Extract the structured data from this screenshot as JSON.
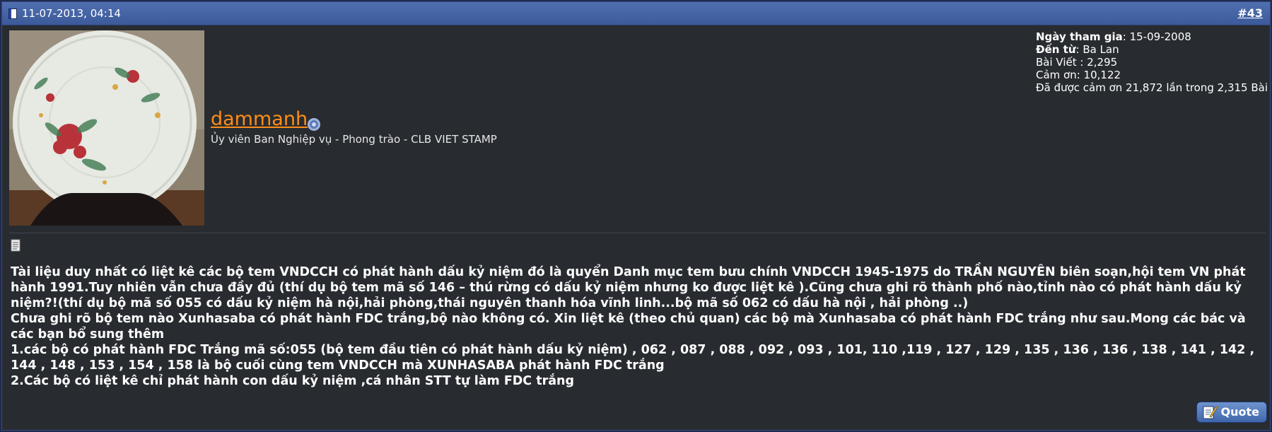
{
  "post": {
    "date": "11-07-2013, 04:14",
    "number_hash": "#",
    "number": "43",
    "username": "dammanh",
    "user_title": "Ủy viên Ban Nghiệp vụ - Phong trào - CLB VIET STAMP",
    "user_info": {
      "join_label": "Ngày tham gia",
      "join_value": ": 15-09-2008",
      "from_label": "Đến từ",
      "from_value": ": Ba Lan",
      "posts": "Bài Viết : 2,295",
      "thanks": "Cảm ơn: 10,122",
      "thanked": "Đã được cảm ơn 21,872 lần trong 2,315 Bài"
    },
    "message": {
      "lines": [
        "Tài liệu duy nhất có liệt kê các bộ tem VNDCCH có phát hành dấu kỷ niệm đó là quyển Danh mục tem bưu chính VNDCCH 1945-1975 do TRẦN NGUYÊN biên soạn,hội tem VN phát hành 1991.Tuy nhiên vẫn chưa đầy đủ (thí dụ bộ tem mã số 146 – thú rừng có dấu kỷ niệm nhưng ko được liệt kê ).Cũng chưa ghi rõ thành phố nào,tỉnh nào có phát hành dấu kỷ niệm?!(thí dụ bộ mã số 055 có dấu kỷ niệm hà nội,hải phòng,thái nguyên thanh hóa vĩnh linh...bộ mã số 062 có dấu hà nội , hải phòng ..)",
        "Chưa ghi rõ bộ tem nào Xunhasaba có phát hành FDC trắng,bộ nào không có. Xin liệt kê (theo chủ quan) các bộ mà Xunhasaba có phát hành FDC trắng như sau.Mong các bác và các bạn bổ sung thêm",
        "1.các bộ có phát hành FDC Trắng mã số:055 (bộ tem đầu tiên có phát hành dấu kỷ niệm) , 062 , 087 , 088 , 092 , 093 , 101, 110 ,119 , 127 , 129 , 135 , 136 , 136 , 138 , 141 , 142 , 144 , 148 , 153 , 154 , 158 là bộ cuối cùng tem VNDCCH mà XUNHASABA phát hành FDC trắng",
        "2.Các bộ có liệt kê chỉ phát hành con dấu kỷ niệm ,cá nhân STT tự làm FDC trắng"
      ]
    },
    "quote_label": "Quote"
  }
}
